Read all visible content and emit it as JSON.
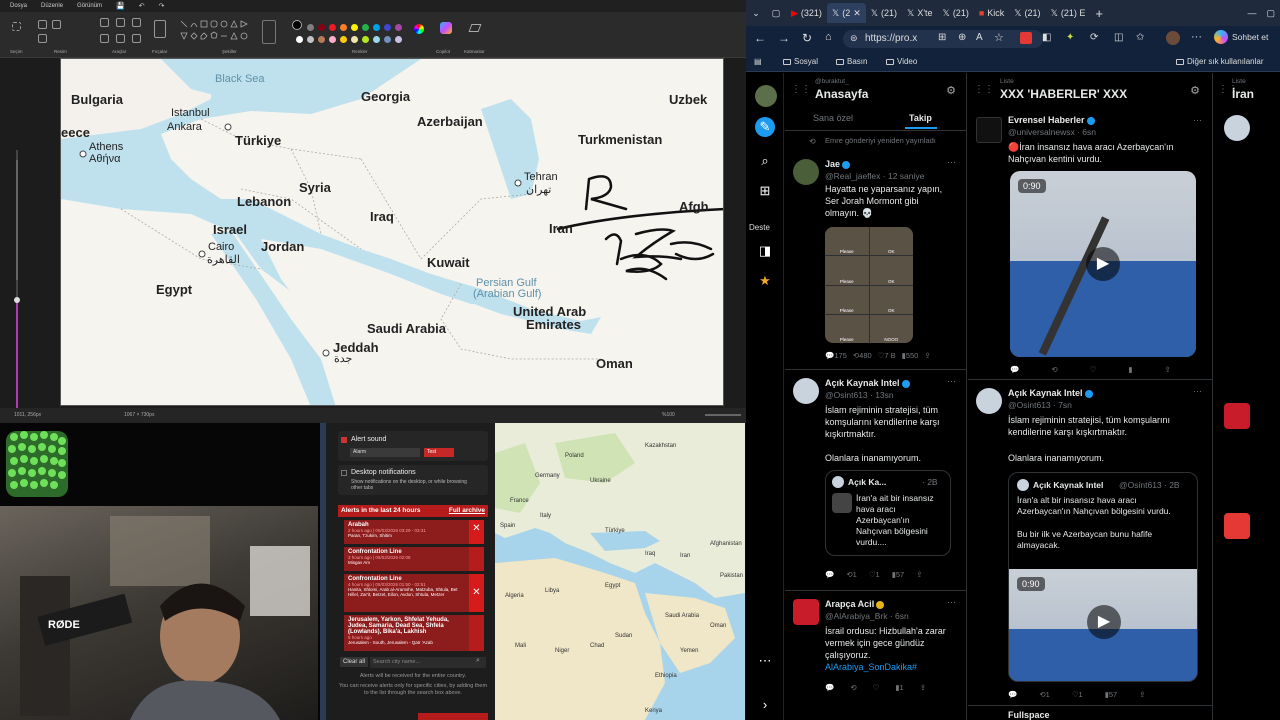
{
  "paint": {
    "menu": [
      "Dosya",
      "Düzenle",
      "Görünüm"
    ],
    "ribbon_groups": [
      "Seçim",
      "Resim",
      "Araçlar",
      "Fırçalar",
      "Şekiller",
      "Renkler",
      "Copilot",
      "Katmanlar"
    ],
    "status_left": "1011, 256px",
    "status_size": "1067 × 730px",
    "zoom": "%100",
    "palette": [
      "#000000",
      "#7f7f7f",
      "#880015",
      "#ed1c24",
      "#ff7f27",
      "#fff200",
      "#22b14c",
      "#00a2e8",
      "#3f48cc",
      "#a349a4",
      "#ffffff",
      "#c3c3c3",
      "#b97a57",
      "#ffaec9",
      "#ffc90e",
      "#efe4b0",
      "#b5e61d",
      "#99d9ea",
      "#7092be",
      "#c8bfe7"
    ]
  },
  "map": {
    "labels": {
      "black_sea": "Black Sea",
      "bulgaria": "Bulgaria",
      "georgia": "Georgia",
      "uzbek": "Uzbek",
      "istanbul": "Istanbul",
      "ankara": "Ankara",
      "azerbaijan": "Azerbaijan",
      "greece": "eece",
      "turkiye": "Türkiye",
      "turkmenistan": "Turkmenistan",
      "athens": "Athens",
      "athens_local": "Αθήνα",
      "tehran": "Tehran",
      "tehran_local": "تهران",
      "syria": "Syria",
      "lebanon": "Lebanon",
      "afgh": "Afgh",
      "iraq": "Iraq",
      "israel": "Israel",
      "iran": "Iran",
      "cairo": "Cairo",
      "cairo_local": "القاهرة",
      "jordan": "Jordan",
      "kuwait": "Kuwait",
      "persian_gulf": "Persian Gulf",
      "arabian_gulf": "(Arabian Gulf)",
      "egypt": "Egypt",
      "uae_1": "United Arab",
      "uae_2": "Emirates",
      "saudi": "Saudi Arabia",
      "jeddah": "Jeddah",
      "jeddah_local": "جدة",
      "oman": "Oman"
    }
  },
  "alerts": {
    "alert_sound_label": "Alert sound",
    "alarm_select": "Alarm",
    "test_button": "Test",
    "desktop_notif_label": "Desktop notifications",
    "desktop_notif_desc": "Show notifications on the desktop, or while browsing other tabs",
    "header": "Alerts in the last 24 hours",
    "full_archive": "Full archive",
    "items": [
      {
        "title": "Arabah",
        "meta": "2 hours ago | 05/03/2026 03:29 - 03:31",
        "areas": "Paran, Tzukim, Shitim"
      },
      {
        "title": "Confrontation Line",
        "meta": "3 hours ago | 05/03/2026 02:08",
        "areas": "Misgav Am"
      },
      {
        "title": "Confrontation Line",
        "meta": "4 hours ago | 05/03/2026 01:50 - 02:51",
        "areas": "Hanita, Shlomi, Arab al-Aramshe, Matzuba, Shtula, Bet Hillel, Zar'it, Betzet, Eilon, Avdon, Shtula, Metzer"
      },
      {
        "title": "Jerusalem, Yarkon, Shfelat Yehuda, Judea, Samaria, Dead Sea, Shfela (Lowlands), Bika'a, Lakhish",
        "meta": "5 hours ago",
        "areas": "Jerusalem - South, Jerusalem - Qatr 'Azab"
      }
    ],
    "clear_all": "Clear all",
    "search_placeholder": "Search city name...",
    "footer_1": "Alerts will be received for the entire country.",
    "footer_2": "You can receive alerts only for specific cities, by adding them to the list through the search box above."
  },
  "minimap": {
    "labels": [
      "Kazakhstan",
      "Ukraine",
      "Germany",
      "France",
      "Spain",
      "Italy",
      "Poland",
      "Türkiye",
      "Iraq",
      "Iran",
      "Afghanistan",
      "Pakistan",
      "Egypt",
      "Libya",
      "Algeria",
      "Saudi Arabia",
      "Sudan",
      "Mali",
      "Niger",
      "Chad",
      "Ethiopia",
      "Yemen",
      "Oman",
      "Kenya"
    ]
  },
  "browser": {
    "tabs": [
      {
        "icon": "youtube-icon",
        "label": "(321)"
      },
      {
        "icon": "x-icon",
        "label": "(2"
      },
      {
        "icon": "x-icon",
        "label": "(21)"
      },
      {
        "icon": "x-icon",
        "label": "X'te"
      },
      {
        "icon": "x-icon",
        "label": "(21)"
      },
      {
        "icon": "kick-icon",
        "label": "Kick"
      },
      {
        "icon": "x-icon",
        "label": "(21)"
      },
      {
        "icon": "x-icon",
        "label": "(21) E"
      }
    ],
    "url": "https://pro.x",
    "copilot_label": "Sohbet et",
    "bookmarks": [
      "Sosyal",
      "Basın",
      "Video"
    ],
    "other_bookmarks": "Diğer sık kullanılanlar",
    "nav_label": "Deste"
  },
  "columns": {
    "home": {
      "handle": "@buraktut_",
      "title": "Anasayfa",
      "tab_for_you": "Sana özel",
      "tab_following": "Takip",
      "retweet_note": "Emre gönderiyi yeniden yayınladı",
      "t1_name": "Jae",
      "t1_handle": "@Real_jaeflex · 12 saniye",
      "t1_text": "Hayatta ne yaparsanız yapın, Ser Jorah Mormont gibi olmayın. 💀",
      "t1_stats": [
        "175",
        "480",
        "7 B",
        "550"
      ],
      "t1_meme": [
        "Please",
        "OK",
        "Please",
        "OK",
        "Please",
        "OK",
        "Please",
        "NOOO"
      ],
      "t2_name": "Açık Kaynak Intel",
      "t2_handle": "@Osint613 · 13sn",
      "t2_text": "İslam rejiminin stratejisi, tüm komşularını kendilerine karşı kışkırtmaktır.",
      "t2_text2": "Olanlara inanamıyorum.",
      "t2_quote_name": "Açık Ka...",
      "t2_quote_time": "· 2B",
      "t2_quote_text": "İran'a ait bir insansız hava aracı Azerbaycan'ın Nahçıvan bölgesini vurdu....",
      "t2_stats": [
        "1",
        "1",
        "57"
      ],
      "t3_name": "Arapça Acil",
      "t3_handle": "@AlArabiya_Brk · 6sn",
      "t3_text": "İsrail ordusu: Hizbullah'a zarar vermek için gece gündüz çalışıyoruz.",
      "t3_hashtag": "AlArabiya_SonDakika#",
      "t3_stats": [
        "1"
      ]
    },
    "news": {
      "list_label": "Liste",
      "title": "XXX 'HABERLER' XXX",
      "t1_name": "Evrensel Haberler",
      "t1_handle": "@universalnewsx · 6sn",
      "t1_text": "🔴İran insansız hava aracı Azerbaycan'ın Nahçıvan kentini vurdu.",
      "t1_time": "0:90",
      "t2_name": "Açık Kaynak Intel",
      "t2_handle": "@Osint613 · 7sn",
      "t2_text": "İslam rejiminin stratejisi, tüm komşularını kendilerine karşı kışkırtmaktır.",
      "t2_text2": "Olanlara inanamıyorum.",
      "t2_quote_name": "Açık Kaynak Intel",
      "t2_quote_handle": "@Osint613 · 2B",
      "t2_quote_text": "İran'a alt bir insansız hava aracı Azerbaycan'ın Nahçıvan bölgesini vurdu.",
      "t2_quote_text2": "Bu bir ilk ve Azerbaycan bunu hafife almayacak.",
      "t2_time": "0:90",
      "t2_stats": [
        "1",
        "1",
        "57"
      ],
      "t3_name": "Fullspace"
    },
    "third": {
      "list_label": "Liste",
      "title": "İran"
    }
  }
}
